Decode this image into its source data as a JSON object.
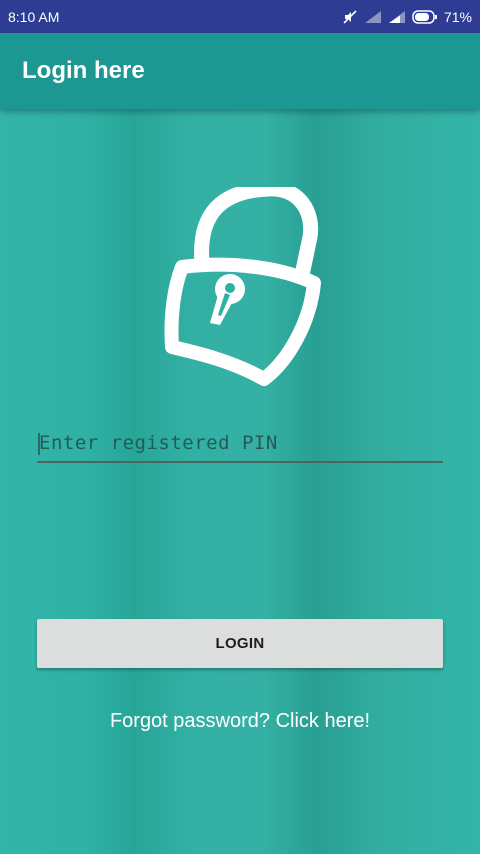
{
  "status_bar": {
    "time": "8:10 AM",
    "battery_percent": "71%",
    "icons": [
      "mute-icon",
      "signal-icon-1",
      "signal-icon-2",
      "battery-icon"
    ]
  },
  "app_bar": {
    "title": "Login here"
  },
  "lock_icon": "padlock-icon",
  "pin_input": {
    "placeholder": "Enter registered PIN",
    "value": ""
  },
  "login_button": {
    "label": "LOGIN"
  },
  "forgot_link": {
    "label": "Forgot password? Click here!"
  },
  "colors": {
    "status_bar": "#2e3d93",
    "app_bar": "#1c9792",
    "background": "#2fb0a4",
    "button": "#dcdede",
    "lock": "#ffffff"
  }
}
